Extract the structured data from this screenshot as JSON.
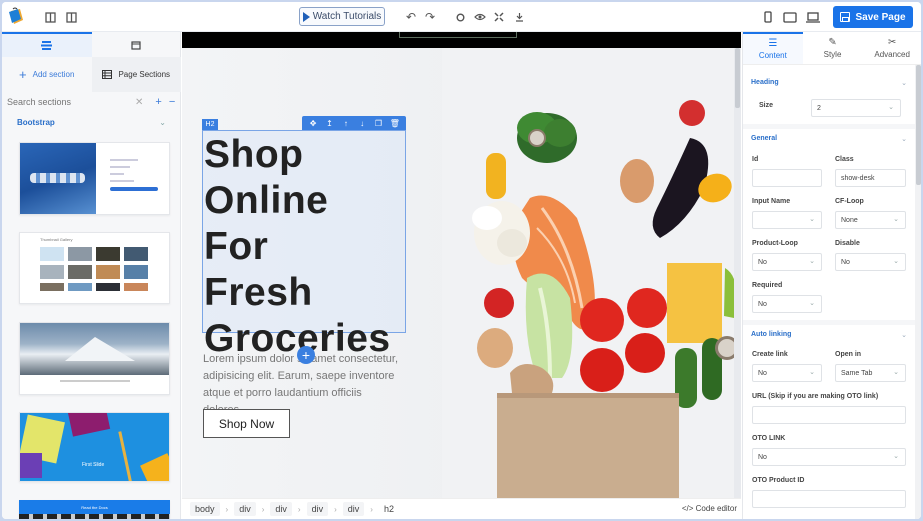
{
  "topbar": {
    "watch_tutorials": "Watch Tutorials",
    "save_page": "Save Page",
    "icons": [
      "layout-left-icon",
      "layout-right-icon",
      "undo-icon",
      "redo-icon",
      "record-icon",
      "preview-eye-icon",
      "fullscreen-icon",
      "download-icon",
      "mobile-device-icon",
      "tablet-device-icon",
      "desktop-device-icon"
    ]
  },
  "left_panel": {
    "tabs": [
      {
        "icon": "blocks-icon",
        "active": true
      },
      {
        "icon": "pages-icon",
        "active": false
      }
    ],
    "add_section": "Add section",
    "page_sections": "Page Sections",
    "search_placeholder": "Search sections",
    "category": "Bootstrap",
    "thumbnails": [
      {
        "name": "login-form-section",
        "caption": ""
      },
      {
        "name": "thumbnail-gallery-section",
        "caption": "Thumbnail Gallery"
      },
      {
        "name": "mountain-banner-section",
        "caption": ""
      },
      {
        "name": "colorful-slide-section",
        "caption": "First Slide"
      },
      {
        "name": "blue-header-section",
        "caption": "Read the Docs"
      }
    ]
  },
  "canvas": {
    "element_badge": "H2",
    "toolbar_icons": [
      "move-icon",
      "select-parent-icon",
      "move-up-icon",
      "move-down-icon",
      "clone-icon",
      "delete-icon"
    ],
    "heading_lines": [
      "Shop",
      "Online",
      "For",
      "Fresh",
      "Groceries"
    ],
    "paragraph": "Lorem ipsum dolor sit amet consectetur, adipisicing elit. Earum, saepe inventore atque et porro laudantium officiis dolores.",
    "button": "Shop Now"
  },
  "breadcrumb": {
    "items": [
      "body",
      "div",
      "div",
      "div",
      "div",
      "h2"
    ],
    "code_editor": "Code editor"
  },
  "right_panel": {
    "tabs": [
      {
        "label": "Content",
        "icon": "sliders-icon",
        "active": true
      },
      {
        "label": "Style",
        "icon": "pencil-icon",
        "active": false
      },
      {
        "label": "Advanced",
        "icon": "tools-icon",
        "active": false
      }
    ],
    "heading_section": {
      "title": "Heading",
      "size_label": "Size",
      "size_value": "2"
    },
    "general_section": {
      "title": "General",
      "id_label": "Id",
      "id_value": "",
      "class_label": "Class",
      "class_value": "show-desk",
      "input_name_label": "Input Name",
      "input_name_value": "",
      "cf_loop_label": "CF-Loop",
      "cf_loop_value": "None",
      "product_loop_label": "Product-Loop",
      "product_loop_value": "No",
      "disable_label": "Disable",
      "disable_value": "No",
      "required_label": "Required",
      "required_value": "No"
    },
    "auto_linking_section": {
      "title": "Auto linking",
      "create_link_label": "Create link",
      "create_link_value": "No",
      "open_in_label": "Open in",
      "open_in_value": "Same Tab",
      "url_label": "URL (Skip if you are making OTO link)",
      "url_value": "",
      "oto_link_label": "OTO LINK",
      "oto_link_value": "No",
      "oto_product_label": "OTO Product ID",
      "oto_product_value": ""
    }
  },
  "colors": {
    "accent": "#1a73e8",
    "selection": "#3a7fe0",
    "section_title": "#2a6fc9"
  }
}
